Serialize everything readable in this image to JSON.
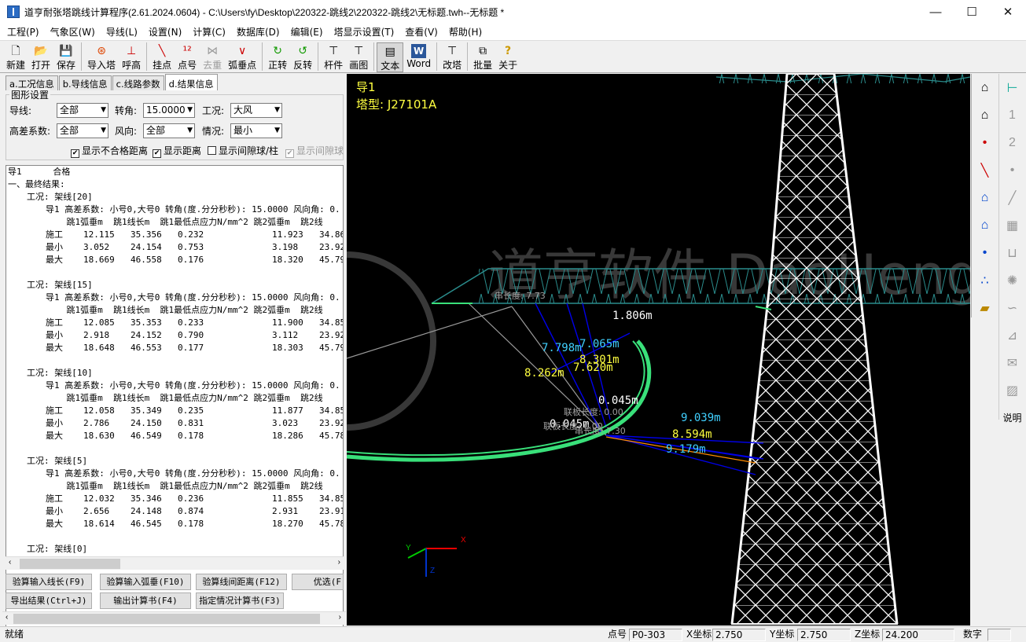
{
  "window": {
    "title": "道亨耐张塔跳线计算程序(2.61.2024.0604) - C:\\Users\\fy\\Desktop\\220322-跳线2\\220322-跳线2\\无标题.twh--无标题 *",
    "minimize": "—",
    "maximize": "☐",
    "close": "✕"
  },
  "menu": [
    "工程(P)",
    "气象区(W)",
    "导线(L)",
    "设置(N)",
    "计算(C)",
    "数据库(D)",
    "编辑(E)",
    "塔显示设置(T)",
    "查看(V)",
    "帮助(H)"
  ],
  "toolbar": [
    {
      "label": "新建",
      "icon": "🗋"
    },
    {
      "label": "打开",
      "icon": "📂"
    },
    {
      "label": "保存",
      "icon": "💾"
    },
    {
      "label": "导入塔",
      "icon": "⊛"
    },
    {
      "label": "呼高",
      "icon": "⊥"
    },
    {
      "label": "挂点",
      "icon": "╲"
    },
    {
      "label": "点号",
      "icon": "¹²"
    },
    {
      "label": "去重",
      "icon": "⋈"
    },
    {
      "label": "弧垂点",
      "icon": "∨"
    },
    {
      "label": "正转",
      "icon": "↻"
    },
    {
      "label": "反转",
      "icon": "↺"
    },
    {
      "label": "杆件",
      "icon": "⊤"
    },
    {
      "label": "画图",
      "icon": "⊤"
    },
    {
      "label": "文本",
      "icon": "▤"
    },
    {
      "label": "Word",
      "icon": "W"
    },
    {
      "label": "改塔",
      "icon": "⊤"
    },
    {
      "label": "批量",
      "icon": "⧉"
    },
    {
      "label": "关于",
      "icon": "?"
    }
  ],
  "tabs": [
    "a.工况信息",
    "b.导线信息",
    "c.线路参数",
    "d.结果信息"
  ],
  "graph_settings": {
    "title": "图形设置",
    "wire_label": "导线:",
    "wire_value": "全部",
    "angle_label": "转角:",
    "angle_value": "15.0000",
    "condition_label": "工况:",
    "condition_value": "大风",
    "height_coef_label": "高差系数:",
    "height_coef_value": "全部",
    "wind_label": "风向:",
    "wind_value": "全部",
    "case_label": "情况:",
    "case_value": "最小",
    "chk1": "显示不合格距离",
    "chk2": "显示距离",
    "chk3": "显示间隙球/柱",
    "chk4": "显示间隙球"
  },
  "result": {
    "header": "导1      合格",
    "final": "一、最终结果:",
    "param_line": "导1 高差系数: 小号0,大号0 转角(度.分分秒秒): 15.0000 风向角: 0.",
    "col_head": "    跳1弧垂m  跳1线长m  跳1最低点应力N/mm^2 跳2弧垂m  跳2线",
    "groups": [
      {
        "title": "工况: 架线[20]",
        "rows": [
          {
            "name": "施工",
            "sag1": "12.115",
            "len1": "35.356",
            "stress1": "0.232",
            "sag2": "11.923",
            "len2": "34.86"
          },
          {
            "name": "最小",
            "sag1": "3.052",
            "len1": "24.154",
            "stress1": "0.753",
            "sag2": "3.198",
            "len2": "23.92"
          },
          {
            "name": "最大",
            "sag1": "18.669",
            "len1": "46.558",
            "stress1": "0.176",
            "sag2": "18.320",
            "len2": "45.79"
          }
        ]
      },
      {
        "title": "工况: 架线[15]",
        "rows": [
          {
            "name": "施工",
            "sag1": "12.085",
            "len1": "35.353",
            "stress1": "0.233",
            "sag2": "11.900",
            "len2": "34.85"
          },
          {
            "name": "最小",
            "sag1": "2.918",
            "len1": "24.152",
            "stress1": "0.790",
            "sag2": "3.112",
            "len2": "23.92"
          },
          {
            "name": "最大",
            "sag1": "18.648",
            "len1": "46.553",
            "stress1": "0.177",
            "sag2": "18.303",
            "len2": "45.79"
          }
        ]
      },
      {
        "title": "工况: 架线[10]",
        "rows": [
          {
            "name": "施工",
            "sag1": "12.058",
            "len1": "35.349",
            "stress1": "0.235",
            "sag2": "11.877",
            "len2": "34.85"
          },
          {
            "name": "最小",
            "sag1": "2.786",
            "len1": "24.150",
            "stress1": "0.831",
            "sag2": "3.023",
            "len2": "23.92"
          },
          {
            "name": "最大",
            "sag1": "18.630",
            "len1": "46.549",
            "stress1": "0.178",
            "sag2": "18.286",
            "len2": "45.78"
          }
        ]
      },
      {
        "title": "工况: 架线[5]",
        "rows": [
          {
            "name": "施工",
            "sag1": "12.032",
            "len1": "35.346",
            "stress1": "0.236",
            "sag2": "11.855",
            "len2": "34.85"
          },
          {
            "name": "最小",
            "sag1": "2.656",
            "len1": "24.148",
            "stress1": "0.874",
            "sag2": "2.931",
            "len2": "23.91"
          },
          {
            "name": "最大",
            "sag1": "18.614",
            "len1": "46.545",
            "stress1": "0.178",
            "sag2": "18.270",
            "len2": "45.78"
          }
        ]
      }
    ],
    "last_group": "工况: 架线[0]"
  },
  "buttons": {
    "b1": "验算输入线长(F9)",
    "b2": "验算输入弧垂(F10)",
    "b3": "验算线间距离(F12)",
    "b4": "优选(F",
    "b5": "导出结果(Ctrl+J)",
    "b6": "输出计算书(F4)",
    "b7": "指定情况计算书(F3)"
  },
  "canvas": {
    "wire": "导1",
    "tower_type": "塔型: J27101A",
    "labels": {
      "d1": "1.806m",
      "d2": "7.798m",
      "d3": "7.065m",
      "d4": "8.301m",
      "d5": "8.262m",
      "d6": "7.620m",
      "d7": "0.045m",
      "d8": "9.039m",
      "d9": "0.045m",
      "d10": "8.594m",
      "d11": "9.179m",
      "plate1": "联板长度: 0.00",
      "plate2": "联板长度: 0.00",
      "insul": "串长度: 7.73",
      "insul2": "串长度: 7.30"
    },
    "axis_x": "X",
    "axis_y": "Y",
    "axis_z": "Z",
    "watermark": "道亨软件 DaoHeng INC"
  },
  "right_tools2": {
    "help": "说明"
  },
  "status": {
    "ready": "就绪",
    "pt_label": "点号",
    "pt_value": "P0-303",
    "x_label": "X坐标",
    "x_value": "2.750",
    "y_label": "Y坐标",
    "y_value": "2.750",
    "z_label": "Z坐标",
    "z_value": "24.200",
    "num": "数字"
  },
  "colors": {
    "tower": "#ffffff",
    "crossarm": "#2a8c8c",
    "jumper": "#39e07a",
    "dist_line": "#0000e0",
    "label_cyan": "#40d0ff",
    "label_yellow": "#ffff40"
  }
}
